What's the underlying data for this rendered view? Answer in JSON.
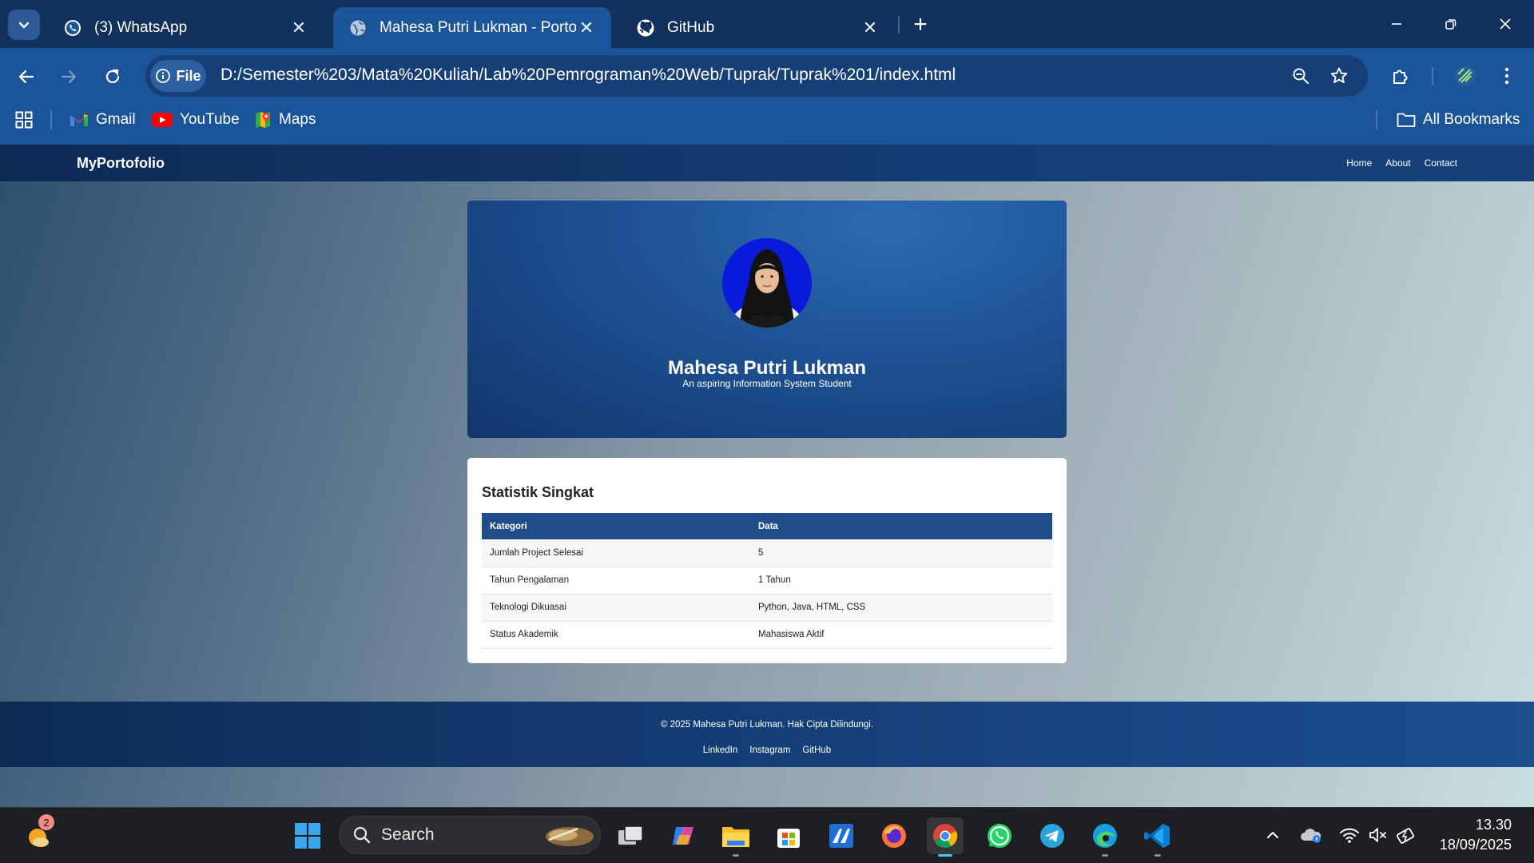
{
  "browser": {
    "tabs": [
      {
        "title": "(3) WhatsApp",
        "icon": "whatsapp-icon",
        "active": false
      },
      {
        "title": "Mahesa Putri Lukman - Portofolio",
        "icon": "globe-icon",
        "active": true
      },
      {
        "title": "GitHub",
        "icon": "github-icon",
        "active": false
      }
    ],
    "site_chip": "File",
    "url": "D:/Semester%203/Mata%20Kuliah/Lab%20Pemrograman%20Web/Tuprak/Tuprak%201/index.html",
    "bookmarks": [
      {
        "label": "Gmail",
        "icon": "gmail-icon"
      },
      {
        "label": "YouTube",
        "icon": "youtube-icon"
      },
      {
        "label": "Maps",
        "icon": "maps-icon"
      }
    ],
    "all_bookmarks": "All Bookmarks"
  },
  "site": {
    "brand": "MyPortofolio",
    "nav": [
      "Home",
      "About",
      "Contact"
    ],
    "hero": {
      "name": "Mahesa Putri Lukman",
      "subtitle": "An aspiring Information System Student"
    },
    "stats": {
      "title": "Statistik Singkat",
      "headers": [
        "Kategori",
        "Data"
      ],
      "rows": [
        [
          "Jumlah Project Selesai",
          "5"
        ],
        [
          "Tahun Pengalaman",
          "1 Tahun"
        ],
        [
          "Teknologi Dikuasai",
          "Python, Java, HTML, CSS"
        ],
        [
          "Status Akademik",
          "Mahasiswa Aktif"
        ]
      ]
    },
    "footer": {
      "copyright": "© 2025 Mahesa Putri Lukman. Hak Cipta Dilindungi.",
      "links": [
        "LinkedIn",
        "Instagram",
        "GitHub"
      ]
    }
  },
  "taskbar": {
    "weather_badge": "2",
    "search_placeholder": "Search",
    "time": "13.30",
    "date": "18/09/2025"
  },
  "colors": {
    "chrome_frame": "#12305c",
    "chrome_toolbar": "#1b5499",
    "site_nav": "#0d2a55",
    "table_header": "#1f4d8a",
    "avatar_bg": "#0a1adb",
    "taskbar": "#1e1f22"
  }
}
